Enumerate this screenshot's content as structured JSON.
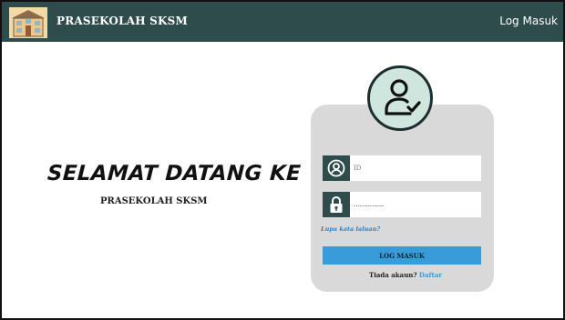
{
  "header": {
    "brand": "PRASEKOLAH SKSM",
    "login_link": "Log Masuk",
    "logo_icon": "school-building-icon"
  },
  "welcome": {
    "heading": "SELAMAT DATANG KE",
    "subheading": "PRASEKOLAH SKSM"
  },
  "login": {
    "avatar_icon": "user-check-icon",
    "id_field": {
      "icon": "user-circle-icon",
      "placeholder": "ID",
      "value": ""
    },
    "password_field": {
      "icon": "lock-icon",
      "value": "..............."
    },
    "forgot_link": "Lupa kata laluan?",
    "submit_label": "LOG MASUK",
    "no_account_text": "Tiada akaun?",
    "register_link": "Daftar"
  },
  "colors": {
    "header_bg": "#2f4c4c",
    "card_bg": "#d9d9d9",
    "accent_blue": "#3a9bd9",
    "avatar_bg": "#cfe6df"
  }
}
